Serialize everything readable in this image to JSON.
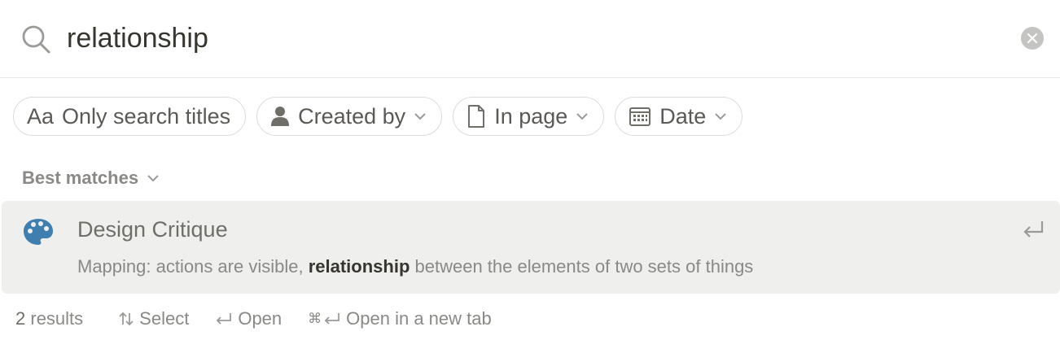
{
  "search": {
    "query": "relationship",
    "icon": "search-icon",
    "clear_icon": "clear-icon"
  },
  "filters": [
    {
      "label": "Only search titles",
      "prefix": "Aa",
      "icon": "text-icon"
    },
    {
      "label": "Created by",
      "icon": "person-icon"
    },
    {
      "label": "In page",
      "icon": "page-icon"
    },
    {
      "label": "Date",
      "icon": "calendar-icon"
    }
  ],
  "section": {
    "label": "Best matches"
  },
  "results": [
    {
      "title": "Design Critique",
      "icon": "palette-icon",
      "snippet_before": "Mapping: actions are visible, ",
      "snippet_match": "relationship",
      "snippet_after": " between the elements of two sets of things"
    }
  ],
  "footer": {
    "count": "2",
    "count_label": " results",
    "select_label": "Select",
    "open_label": "Open",
    "open_new_tab_label": "Open in a new tab"
  },
  "colors": {
    "accent_icon": "#3f7fb0",
    "row_highlight": "#efefee",
    "border": "#dcdcda"
  }
}
